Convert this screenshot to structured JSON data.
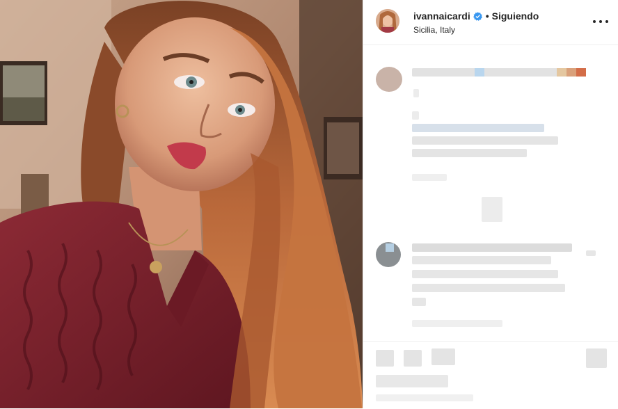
{
  "post": {
    "username": "ivannaicardi",
    "follow_status": "Siguiendo",
    "location": "Sicilia, Italy"
  },
  "icons": {
    "verified": "verified-badge-icon",
    "more": "more-options-icon"
  },
  "colors": {
    "verified_blue": "#3897f0",
    "text": "#262626",
    "sweater": "#7a1f2b",
    "hair": "#b9683a"
  }
}
